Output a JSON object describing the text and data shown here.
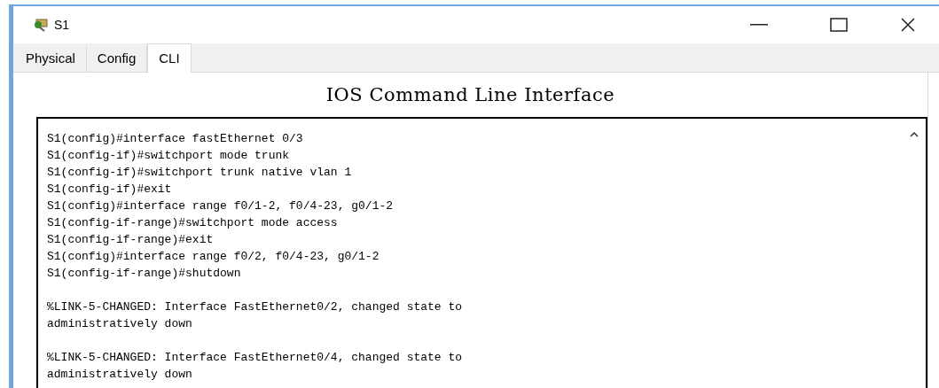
{
  "window": {
    "title": "S1"
  },
  "tabs": [
    {
      "label": "Physical",
      "selected": false
    },
    {
      "label": "Config",
      "selected": false
    },
    {
      "label": "CLI",
      "selected": true
    }
  ],
  "heading": "IOS Command Line Interface",
  "terminal": {
    "blocks": [
      [
        "S1(config)#interface fastEthernet 0/3",
        "S1(config-if)#switchport mode trunk",
        "S1(config-if)#switchport trunk native vlan 1",
        "S1(config-if)#exit",
        "S1(config)#interface range f0/1-2, f0/4-23, g0/1-2",
        "S1(config-if-range)#switchport mode access",
        "S1(config-if-range)#exit",
        "S1(config)#interface range f0/2, f0/4-23, g0/1-2",
        "S1(config-if-range)#shutdown"
      ],
      [
        "%LINK-5-CHANGED: Interface FastEthernet0/2, changed state to",
        "administratively down"
      ],
      [
        "%LINK-5-CHANGED: Interface FastEthernet0/4, changed state to",
        "administratively down"
      ]
    ]
  }
}
